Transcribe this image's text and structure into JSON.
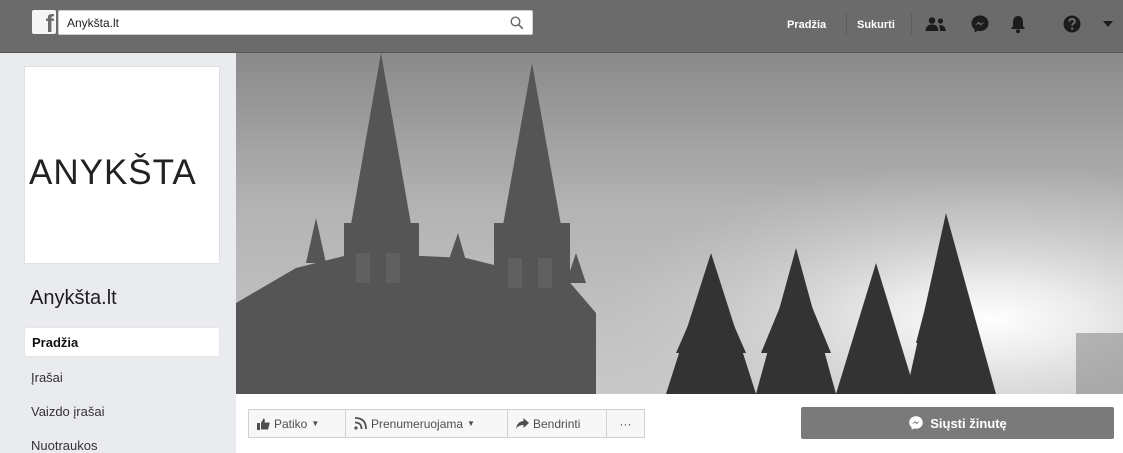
{
  "topbar": {
    "logo": "f",
    "search_value": "Anykšta.lt",
    "nav_home": "Pradžia",
    "nav_create": "Sukurti",
    "icons": [
      "friends-icon",
      "messenger-icon",
      "notifications-icon",
      "help-icon",
      "account-menu-icon"
    ]
  },
  "profile": {
    "logo_text": "ANYKŠTA",
    "page_name": "Anykšta.lt"
  },
  "sidebar": {
    "items": [
      {
        "label": "Pradžia",
        "active": true
      },
      {
        "label": "Įrašai"
      },
      {
        "label": "Vaizdo įrašai"
      },
      {
        "label": "Nuotraukos"
      }
    ]
  },
  "actions": {
    "like": "Patiko",
    "follow": "Prenumeruojama",
    "share": "Bendrinti",
    "more": "···",
    "message": "Siųsti žinutę"
  },
  "colors": {
    "topbar": "#6b6b6b",
    "page_bg": "#e9ebee",
    "message_button": "#7a7a7a"
  }
}
